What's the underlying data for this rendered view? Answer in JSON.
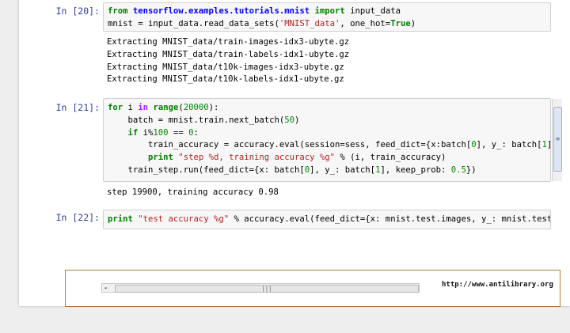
{
  "cells": [
    {
      "prompt_prefix": "In ",
      "prompt_number": "[20]:",
      "code_lines": [
        [
          {
            "t": "from ",
            "c": "kw"
          },
          {
            "t": "tensorflow.examples.tutorials.mnist",
            "c": "mod"
          },
          {
            "t": " ",
            "c": ""
          },
          {
            "t": "import",
            "c": "kw"
          },
          {
            "t": " input_data",
            "c": ""
          }
        ],
        [
          {
            "t": "mnist = input_data.read_data_sets(",
            "c": ""
          },
          {
            "t": "'MNIST_data'",
            "c": "str"
          },
          {
            "t": ", one_hot=",
            "c": ""
          },
          {
            "t": "True",
            "c": "kw"
          },
          {
            "t": ")",
            "c": ""
          }
        ]
      ],
      "output_lines": [
        "Extracting MNIST_data/train-images-idx3-ubyte.gz",
        "Extracting MNIST_data/train-labels-idx1-ubyte.gz",
        "Extracting MNIST_data/t10k-images-idx3-ubyte.gz",
        "Extracting MNIST_data/t10k-labels-idx1-ubyte.gz"
      ]
    },
    {
      "prompt_prefix": "In ",
      "prompt_number": "[21]:",
      "code_lines": [
        [
          {
            "t": "for",
            "c": "kw"
          },
          {
            "t": " i ",
            "c": ""
          },
          {
            "t": "in",
            "c": "op"
          },
          {
            "t": " ",
            "c": ""
          },
          {
            "t": "range",
            "c": "kw"
          },
          {
            "t": "(",
            "c": ""
          },
          {
            "t": "20000",
            "c": "num-lit"
          },
          {
            "t": "):",
            "c": ""
          }
        ],
        [
          {
            "t": "    batch = mnist.train.next_batch(",
            "c": ""
          },
          {
            "t": "50",
            "c": "num-lit"
          },
          {
            "t": ")",
            "c": ""
          }
        ],
        [
          {
            "t": "    ",
            "c": ""
          },
          {
            "t": "if",
            "c": "kw"
          },
          {
            "t": " i%",
            "c": ""
          },
          {
            "t": "100",
            "c": "num-lit"
          },
          {
            "t": " == ",
            "c": ""
          },
          {
            "t": "0",
            "c": "num-lit"
          },
          {
            "t": ":",
            "c": ""
          }
        ],
        [
          {
            "t": "        train_accuracy = accuracy.eval(session=sess, feed_dict={x:batch[",
            "c": ""
          },
          {
            "t": "0",
            "c": "num-lit"
          },
          {
            "t": "], y_: batch[",
            "c": ""
          },
          {
            "t": "1",
            "c": "num-lit"
          },
          {
            "t": "]",
            "c": ""
          }
        ],
        [
          {
            "t": "        ",
            "c": ""
          },
          {
            "t": "print",
            "c": "kw"
          },
          {
            "t": " ",
            "c": ""
          },
          {
            "t": "\"step %d, training accuracy %g\"",
            "c": "str"
          },
          {
            "t": " % (i, train_accuracy)",
            "c": ""
          }
        ],
        [
          {
            "t": "    train_step.run(feed_dict={x: batch[",
            "c": ""
          },
          {
            "t": "0",
            "c": "num-lit"
          },
          {
            "t": "], y_: batch[",
            "c": ""
          },
          {
            "t": "1",
            "c": "num-lit"
          },
          {
            "t": "], keep_prob: ",
            "c": ""
          },
          {
            "t": "0.5",
            "c": "num-lit"
          },
          {
            "t": "})",
            "c": ""
          }
        ]
      ],
      "output_lines": [
        "step 19900, training accuracy 0.98"
      ]
    },
    {
      "prompt_prefix": "In ",
      "prompt_number": "[22]:",
      "code_lines": [
        [
          {
            "t": "print",
            "c": "kw"
          },
          {
            "t": " ",
            "c": ""
          },
          {
            "t": "\"test accuracy %g\"",
            "c": "str"
          },
          {
            "t": " % accuracy.eval(feed_dict={x: mnist.test.images, y_: mnist.test",
            "c": ""
          }
        ]
      ],
      "output_lines": []
    }
  ],
  "scroll_grip": "|||",
  "scroll_left_arrow": "◂",
  "vscroll_grip": "≡",
  "watermark": "http://www.antilibrary.org"
}
